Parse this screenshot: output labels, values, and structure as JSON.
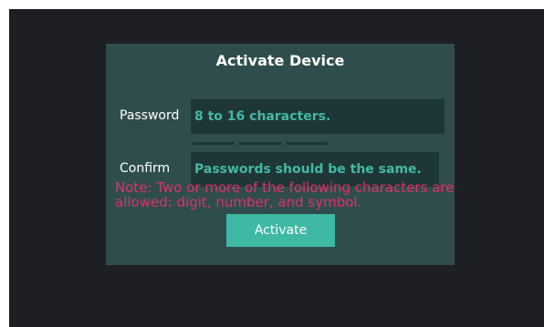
{
  "dialog": {
    "title": "Activate Device",
    "password": {
      "label": "Password",
      "placeholder": "8 to 16 characters."
    },
    "confirm": {
      "label": "Confirm",
      "placeholder": "Passwords should be the same."
    },
    "note": "Note: Two or more of the following characters are allowed: digit, number, and symbol.",
    "activate_label": "Activate"
  },
  "colors": {
    "background": "#1e1f25",
    "panel": "#2f4d4d",
    "input": "#1f3636",
    "accent": "#3fb8a4",
    "note": "#e0306b"
  }
}
